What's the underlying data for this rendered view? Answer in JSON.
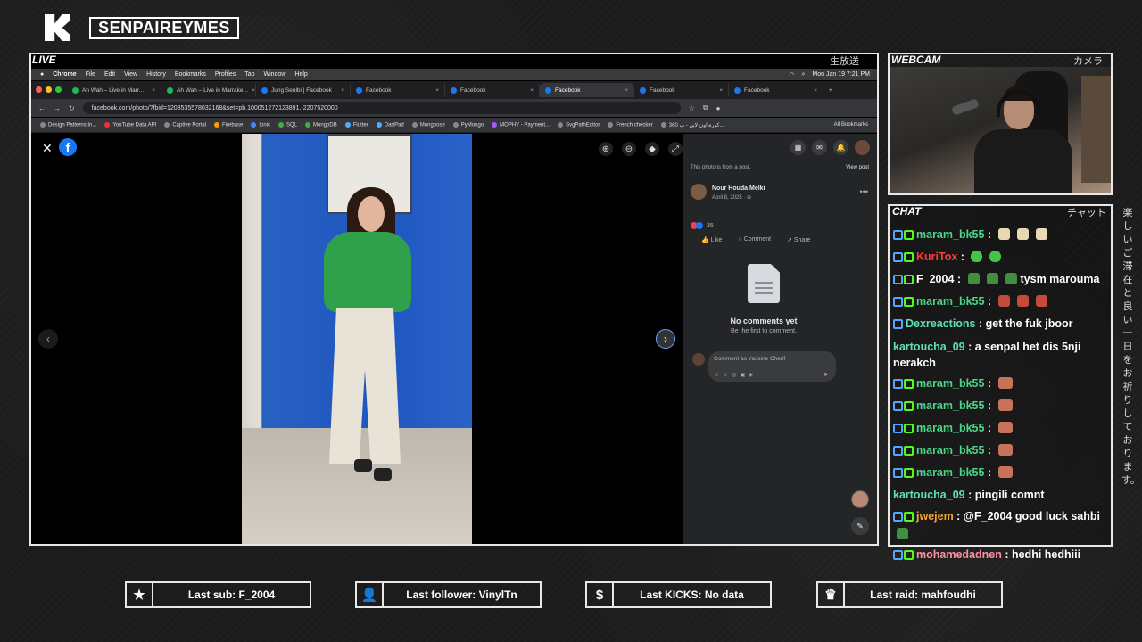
{
  "overlay": {
    "channel_name": "SENPAIREYMES",
    "live_label": "LIVE",
    "live_jp": "生放送",
    "webcam_label": "WEBCAM",
    "webcam_jp": "カメラ",
    "chat_label": "CHAT",
    "chat_jp": "チャット",
    "side_jp": "楽しいご滞在と良い一日をお祈りしております。"
  },
  "mac_menu": {
    "app": "Chrome",
    "items": [
      "File",
      "Edit",
      "View",
      "History",
      "Bookmarks",
      "Profiles",
      "Tab",
      "Window",
      "Help"
    ],
    "clock": "Mon Jan 19  7:21 PM"
  },
  "browser": {
    "tabs": [
      {
        "label": "Ah Wah – Live in Marr...",
        "icon": "spotify-icon"
      },
      {
        "label": "Ah Wah – Live in Marrake...",
        "icon": "spotify-icon"
      },
      {
        "label": "Jung Seulbi | Facebook",
        "icon": "facebook-icon"
      },
      {
        "label": "Facebook",
        "icon": "facebook-icon"
      },
      {
        "label": "Facebook",
        "icon": "facebook-icon"
      },
      {
        "label": "Facebook",
        "icon": "facebook-icon",
        "active": true
      },
      {
        "label": "Facebook",
        "icon": "facebook-icon"
      },
      {
        "label": "Facebook",
        "icon": "facebook-icon"
      }
    ],
    "url": "facebook.com/photo/?fbid=1203535578032168&set=pb.100051272123891.-2207520000",
    "bookmarks": [
      "Design Patterns In...",
      "YouTube Data API",
      "Captive Portal",
      "Firebase",
      "Ionic",
      "SQL",
      "MongoDB",
      "Flutter",
      "DartPad",
      "Mongoose",
      "PyMongo",
      "MOPHY - Payment...",
      "SvgPathEditor",
      "French checker",
      "360 كورة اون لاين - ب..."
    ],
    "all_bookmarks": "All Bookmarks"
  },
  "facebook": {
    "from_post": "This photo is from a post.",
    "view_post": "View post",
    "author": "Nour Houda Melki",
    "date": "April 8, 2025 · ",
    "reaction_count": "35",
    "like": "Like",
    "comment": "Comment",
    "share": "Share",
    "no_comments": "No comments yet",
    "be_first": "Be the first to comment.",
    "comment_placeholder": "Comment as Yassine Cherif"
  },
  "chat": [
    {
      "user": "maram_bk55",
      "color": "#4cd68a",
      "badges": true,
      "text": "",
      "emotes": [
        "peach",
        "peach",
        "peach"
      ]
    },
    {
      "user": "KuriTox",
      "color": "#ff3b3b",
      "badges": true,
      "text": "",
      "emotes": [
        "heart",
        "heart"
      ]
    },
    {
      "user": "F_2004",
      "color": "#ffffff",
      "badges": true,
      "text": "tysm marouma",
      "emotes": [
        "frog",
        "frog",
        "frog"
      ]
    },
    {
      "user": "maram_bk55",
      "color": "#4cd68a",
      "badges": true,
      "text": "",
      "emotes": [
        "box",
        "box",
        "box"
      ]
    },
    {
      "user": "Dexreactions",
      "color": "#5de0b4",
      "badges": true,
      "single": true,
      "text": "get the fuk jboor",
      "emotes": []
    },
    {
      "user": "kartoucha_09",
      "color": "#5de0b4",
      "badges": false,
      "text": "a senpal het dis 5nji nerakch",
      "emotes": [],
      "wrap": true
    },
    {
      "user": "maram_bk55",
      "color": "#4cd68a",
      "badges": true,
      "text": "",
      "emotes": [
        "face"
      ]
    },
    {
      "user": "maram_bk55",
      "color": "#4cd68a",
      "badges": true,
      "text": "",
      "emotes": [
        "face"
      ]
    },
    {
      "user": "maram_bk55",
      "color": "#4cd68a",
      "badges": true,
      "text": "",
      "emotes": [
        "face"
      ]
    },
    {
      "user": "maram_bk55",
      "color": "#4cd68a",
      "badges": true,
      "text": "",
      "emotes": [
        "face"
      ]
    },
    {
      "user": "maram_bk55",
      "color": "#4cd68a",
      "badges": true,
      "text": "",
      "emotes": [
        "face"
      ]
    },
    {
      "user": "kartoucha_09",
      "color": "#5de0b4",
      "badges": false,
      "text": "pingili comnt",
      "emotes": []
    },
    {
      "user": "jwejem",
      "color": "#f2a33a",
      "badges": true,
      "text": "@F_2004 good luck sahbi",
      "emotes": [
        "frog"
      ],
      "emotes_after": true,
      "wrap": true
    },
    {
      "user": "mohamedadnen",
      "color": "#ff8fa3",
      "badges": true,
      "text": "hedhi hedhiii",
      "emotes": []
    }
  ],
  "stats": [
    {
      "icon": "star-icon",
      "glyph": "★",
      "label": "Last sub: F_2004"
    },
    {
      "icon": "add-user-icon",
      "glyph": "👤",
      "label": "Last follower: VinylTn"
    },
    {
      "icon": "dollar-icon",
      "glyph": "$",
      "label": "Last KICKS: No data"
    },
    {
      "icon": "crown-icon",
      "glyph": "♛",
      "label": "Last raid: mahfoudhi"
    }
  ]
}
